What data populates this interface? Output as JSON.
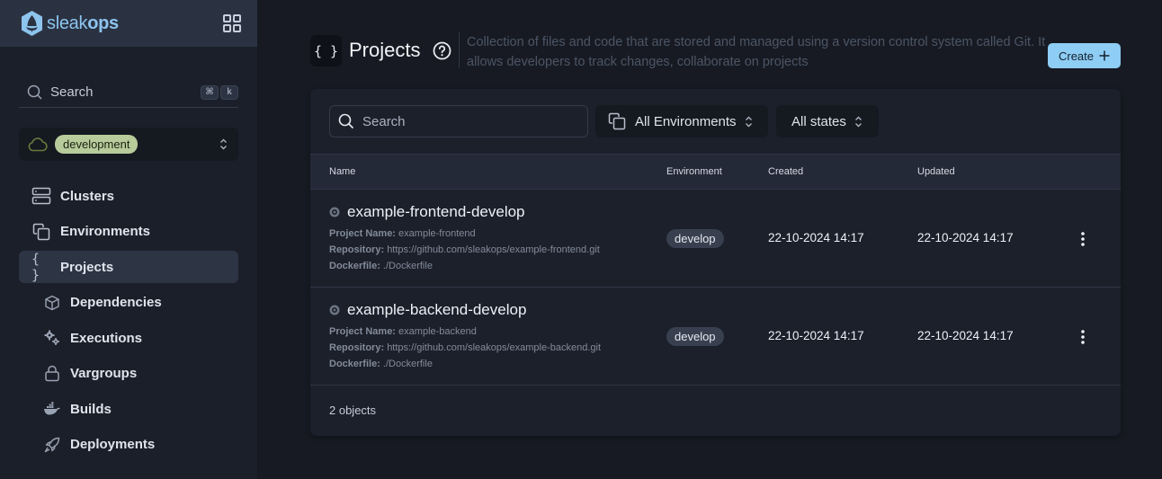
{
  "app": {
    "brand_light": "sleak",
    "brand_bold": "ops",
    "brand_color": "#8dc4ee"
  },
  "sidebar": {
    "search_label": "Search",
    "shortcut_keys": [
      "⌘",
      "k"
    ],
    "environment": {
      "selected": "development",
      "badge_color": "#b7cc9a"
    },
    "items": [
      {
        "label": "Clusters",
        "icon": "server-icon",
        "active": false
      },
      {
        "label": "Environments",
        "icon": "copy-icon",
        "active": false
      },
      {
        "label": "Projects",
        "icon": "braces-icon",
        "active": true
      },
      {
        "label": "Dependencies",
        "icon": "cube-icon",
        "active": false
      },
      {
        "label": "Executions",
        "icon": "gears-icon",
        "active": false
      },
      {
        "label": "Vargroups",
        "icon": "lock-icon",
        "active": false
      },
      {
        "label": "Builds",
        "icon": "docker-icon",
        "active": false
      },
      {
        "label": "Deployments",
        "icon": "rocket-icon",
        "active": false
      }
    ]
  },
  "header": {
    "icon_glyph": "{ }",
    "title": "Projects",
    "description": "Collection of files and code that are stored and managed using a version control system called Git. It allows developers to track changes, collaborate on projects",
    "create_label": "Create",
    "create_color": "#8ecdf4"
  },
  "toolbar": {
    "search_placeholder": "Search",
    "search_value": "",
    "environment_filter": "All Environments",
    "state_filter": "All states"
  },
  "table": {
    "columns": [
      "Name",
      "Environment",
      "Created",
      "Updated"
    ],
    "meta_labels": {
      "project_name": "Project Name:",
      "repository": "Repository:",
      "dockerfile": "Dockerfile:"
    },
    "rows": [
      {
        "name": "example-frontend-develop",
        "project_name": "example-frontend",
        "repository": "https://github.com/sleakops/example-frontend.git",
        "dockerfile": "./Dockerfile",
        "environment": "develop",
        "created": "22-10-2024 14:17",
        "updated": "22-10-2024 14:17"
      },
      {
        "name": "example-backend-develop",
        "project_name": "example-backend",
        "repository": "https://github.com/sleakops/example-backend.git",
        "dockerfile": "./Dockerfile",
        "environment": "develop",
        "created": "22-10-2024 14:17",
        "updated": "22-10-2024 14:17"
      }
    ],
    "footer": "2 objects"
  }
}
